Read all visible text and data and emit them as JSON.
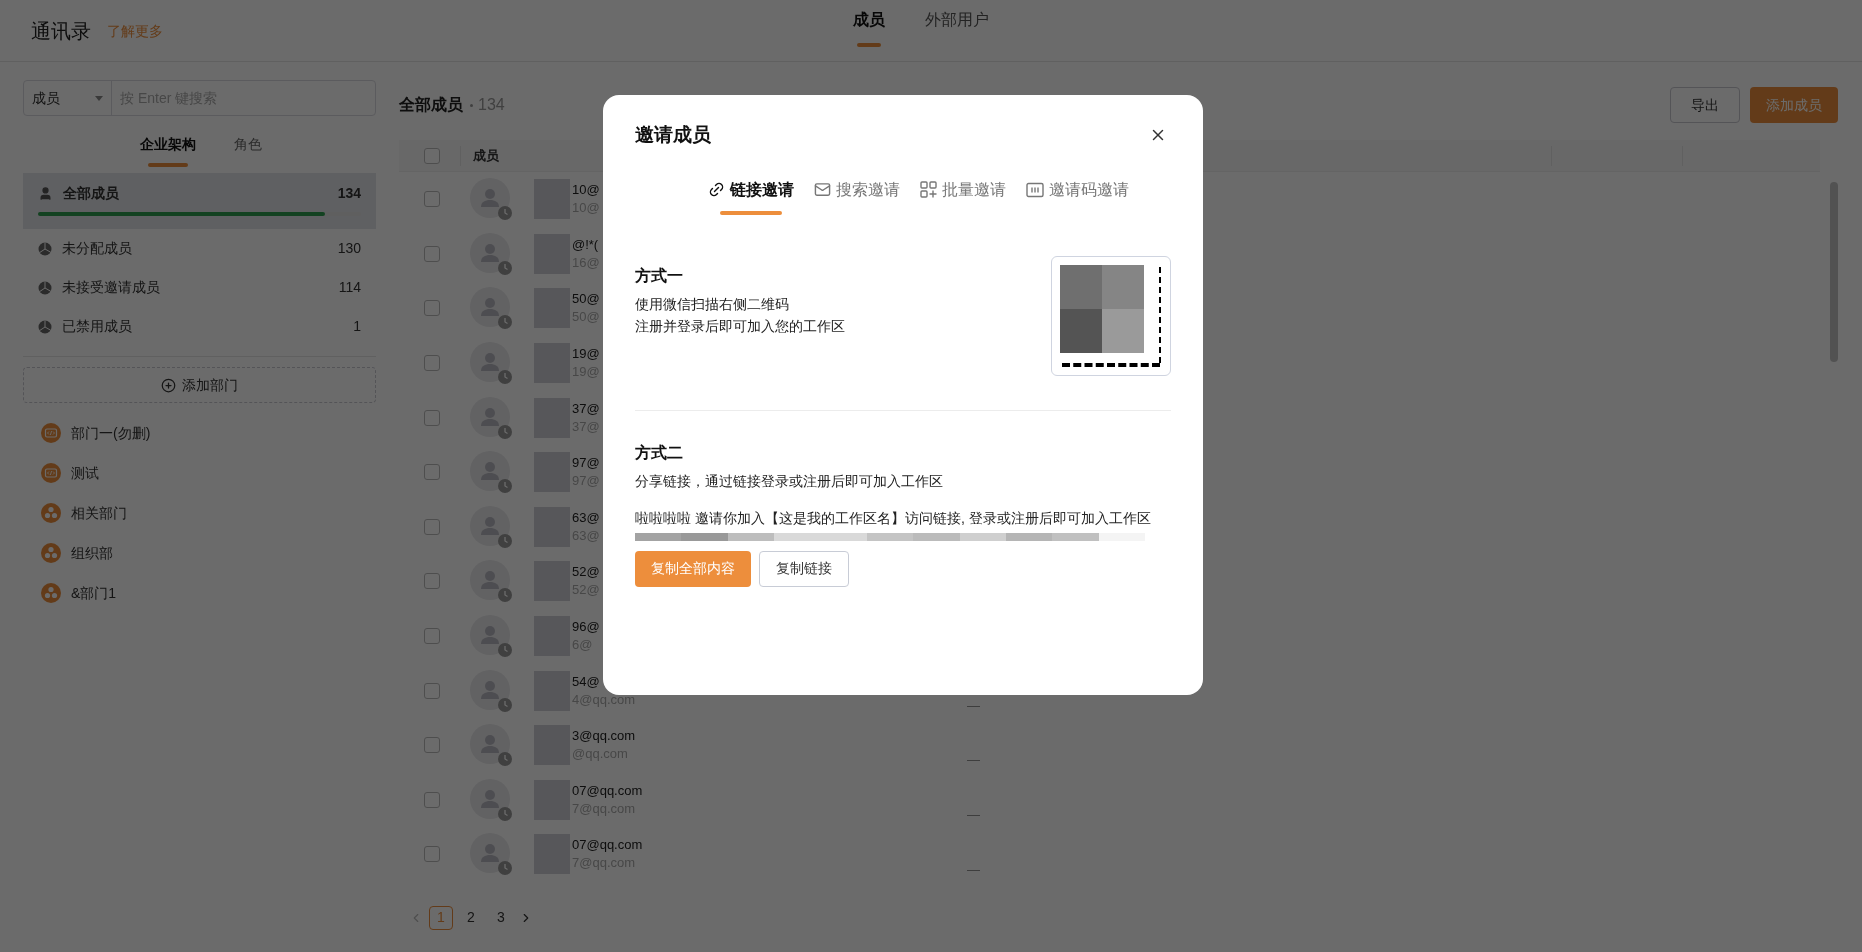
{
  "header": {
    "title": "通讯录",
    "link": "了解更多"
  },
  "top_tabs": [
    {
      "label": "成员",
      "selected": true
    },
    {
      "label": "外部用户",
      "selected": false
    }
  ],
  "sidebar": {
    "search": {
      "scope": "成员",
      "placeholder": "按 Enter 键搜索"
    },
    "tabs": [
      {
        "label": "企业架构",
        "selected": true
      },
      {
        "label": "角色",
        "selected": false
      }
    ],
    "groups": [
      {
        "kind": "all",
        "label": "全部成员",
        "count": "134",
        "selected": true,
        "level": 0.89
      },
      {
        "kind": "status",
        "label": "未分配成员",
        "count": "130",
        "selected": false
      },
      {
        "kind": "status",
        "label": "未接受邀请成员",
        "count": "114",
        "selected": false
      },
      {
        "kind": "status",
        "label": "已禁用成员",
        "count": "1",
        "selected": false
      }
    ],
    "add_button": "添加部门",
    "departments": [
      {
        "kind": "code",
        "label": "部门一(勿删)"
      },
      {
        "kind": "code",
        "label": "测试"
      },
      {
        "kind": "org",
        "label": "相关部门"
      },
      {
        "kind": "org",
        "label": "组织部"
      },
      {
        "kind": "org",
        "label": "&部门1"
      }
    ]
  },
  "main": {
    "title": "全部成员",
    "count": "134",
    "export_button": "导出",
    "add_button": "添加成员",
    "table": {
      "header_checked": false,
      "columns": [
        "成员"
      ],
      "rows": [
        {
          "checked": false,
          "name": "10@",
          "email": "10@"
        },
        {
          "checked": false,
          "name": "@!*(",
          "email": "16@"
        },
        {
          "checked": false,
          "name": "50@",
          "email": "50@"
        },
        {
          "checked": false,
          "name": "19@",
          "email": "19@"
        },
        {
          "checked": false,
          "name": "37@",
          "email": "37@"
        },
        {
          "checked": false,
          "name": "97@",
          "email": "97@"
        },
        {
          "checked": false,
          "name": "63@",
          "email": "63@"
        },
        {
          "checked": false,
          "name": "52@",
          "email": "52@"
        },
        {
          "checked": false,
          "name": "96@",
          "email": "6@"
        },
        {
          "checked": false,
          "name": "54@",
          "email": "4@qq.com",
          "column_3": "—"
        },
        {
          "checked": false,
          "name": "3@qq.com",
          "email": "@qq.com",
          "column_3": "—"
        },
        {
          "checked": false,
          "name": "07@qq.com",
          "email": "7@qq.com",
          "column_3": "—"
        },
        {
          "checked": false,
          "name": "07@qq.com",
          "email": "7@qq.com",
          "column_3": "—"
        }
      ]
    },
    "pagination": [
      {
        "label": "1",
        "selected": true
      },
      {
        "label": "2",
        "selected": false
      },
      {
        "label": "3",
        "selected": false
      }
    ]
  },
  "dialog": {
    "title": "邀请成员",
    "tabs": [
      {
        "kind": "link",
        "label": "链接邀请",
        "selected": true
      },
      {
        "kind": "mail",
        "label": "搜索邀请",
        "selected": false
      },
      {
        "kind": "batch",
        "label": "批量邀请",
        "selected": false
      },
      {
        "kind": "code",
        "label": "邀请码邀请",
        "selected": false
      }
    ],
    "method_one": {
      "title": "方式一",
      "lines": [
        "使用微信扫描右侧二维码",
        "注册并登录后即可加入您的工作区"
      ]
    },
    "method_two": {
      "title": "方式二",
      "description": "分享链接，通过链接登录或注册后即可加入工作区",
      "invite_text": "啦啦啦啦 邀请你加入【这是我的工作区名】访问链接, 登录或注册后即可加入工作区"
    },
    "buttons": [
      {
        "kind": "primary",
        "label": "复制全部内容"
      },
      {
        "kind": "secondary",
        "label": "复制链接"
      }
    ]
  }
}
